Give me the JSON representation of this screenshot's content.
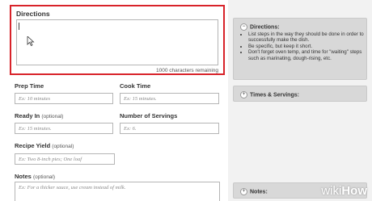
{
  "directions": {
    "label": "Directions",
    "remaining": "1000 characters remaining"
  },
  "fields": {
    "prep_time": {
      "label": "Prep Time",
      "placeholder": "Ex: 10 minutes"
    },
    "cook_time": {
      "label": "Cook Time",
      "placeholder": "Ex: 15 minutes."
    },
    "ready_in": {
      "label": "Ready In",
      "optional": "(optional)",
      "placeholder": "Ex: 15 minutes."
    },
    "servings": {
      "label": "Number of Servings",
      "placeholder": "Ex: 6."
    },
    "yield": {
      "label": "Recipe Yield",
      "optional": "(optional)",
      "placeholder": "Ex: Two 8-inch pies; One loaf"
    },
    "notes": {
      "label": "Notes",
      "optional": "(optional)",
      "placeholder": "Ex: For a thicker sauce, use cream instead of milk."
    }
  },
  "sidebar": {
    "directions_panel": {
      "title": "Directions:",
      "toggle": "−",
      "tips": [
        "List steps in the way they should be done in order to successfully make the dish.",
        "Be specific, but keep it short.",
        "Don't forget oven temp, and time for \"waiting\" steps such as marinating, dough-rising, etc."
      ]
    },
    "times_panel": {
      "title": "Times & Servings:",
      "toggle": "+"
    },
    "notes_panel": {
      "title": "Notes:",
      "toggle": "+"
    }
  },
  "watermark": {
    "wiki": "wiki",
    "how": "How"
  }
}
